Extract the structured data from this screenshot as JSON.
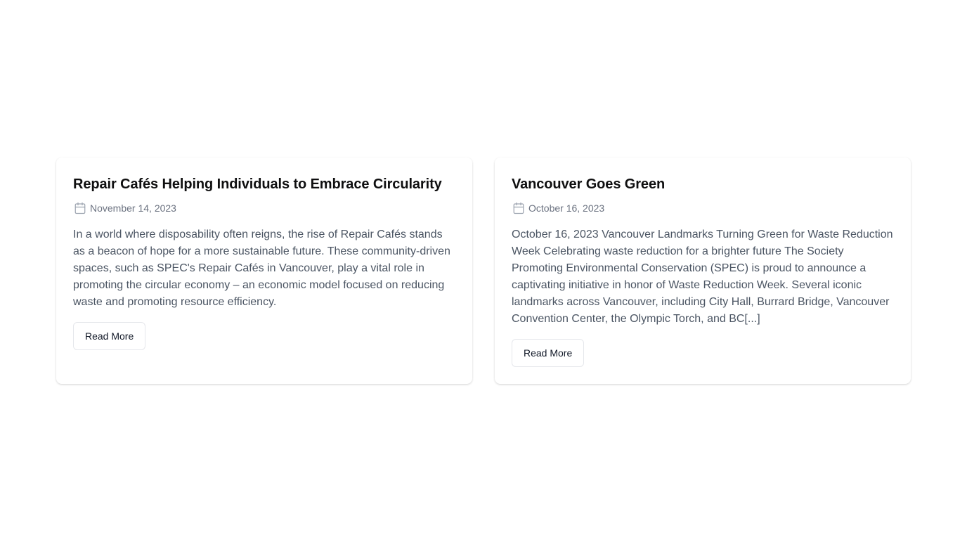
{
  "posts": [
    {
      "title": "Repair Cafés Helping Individuals to Embrace Circularity",
      "date": "November 14, 2023",
      "excerpt": "In a world where disposability often reigns, the rise of Repair Cafés stands as a beacon of hope for a more sustainable future. These community-driven spaces, such as SPEC's Repair Cafés in Vancouver, play a vital role in promoting the circular economy – an economic model focused on reducing waste and promoting resource efficiency.",
      "button_label": "Read More"
    },
    {
      "title": "Vancouver Goes Green",
      "date": "October 16, 2023",
      "excerpt": "October 16, 2023 Vancouver Landmarks Turning Green for Waste Reduction Week Celebrating waste reduction for a brighter future The Society Promoting Environmental Conservation (SPEC) is proud to announce a captivating initiative in honor of Waste Reduction Week. Several iconic landmarks across Vancouver, including City Hall, Burrard Bridge, Vancouver Convention Center, the Olympic Torch, and BC[...]",
      "button_label": "Read More"
    }
  ],
  "icons": {
    "date_icon": "calendar-icon"
  },
  "colors": {
    "title": "#0f0f10",
    "meta": "#6b7280",
    "body": "#4b5563",
    "button_border": "#e5e7eb"
  }
}
